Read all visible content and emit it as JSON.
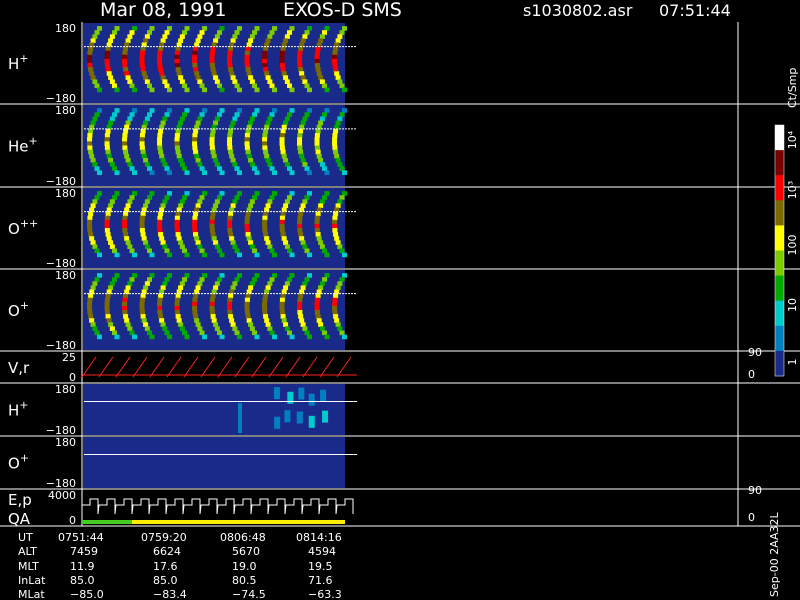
{
  "header": {
    "date": "Mar 08, 1991",
    "instrument": "EXOS-D SMS",
    "filename": "s1030802.asr",
    "time": "07:51:44"
  },
  "colorbar": {
    "unit_label": "Ct/Smp",
    "tick_labels": [
      "10⁴",
      "10³",
      "100",
      "10",
      "1"
    ],
    "tick_values": [
      10000,
      1000,
      100,
      10,
      1
    ],
    "colors": [
      "#ffffff",
      "#7a0000",
      "#ff0000",
      "#7a6a00",
      "#ffff00",
      "#7dcc00",
      "#00aa00",
      "#00cccc",
      "#0080c0",
      "#1a2a8a"
    ]
  },
  "side_annotation": "Sep-00  2AA32L",
  "chart_data": {
    "type": "heatmap",
    "x_axis": "UT",
    "panels": [
      {
        "label": "H",
        "superscript": "+",
        "y_top": "180",
        "y_bottom": "−180",
        "kind": "pitch-angle spectrogram"
      },
      {
        "label": "He",
        "superscript": "+",
        "y_top": "180",
        "y_bottom": "−180",
        "kind": "pitch-angle spectrogram"
      },
      {
        "label": "O",
        "superscript": "++",
        "y_top": "180",
        "y_bottom": "−180",
        "kind": "pitch-angle spectrogram"
      },
      {
        "label": "O",
        "superscript": "+",
        "y_top": "180",
        "y_bottom": "−180",
        "kind": "pitch-angle spectrogram"
      },
      {
        "label": "V,r",
        "superscript": "",
        "y_top": "25",
        "y_bottom": "0",
        "right_top": "90",
        "right_bottom": "0",
        "kind": "line"
      },
      {
        "label": "H",
        "superscript": "+",
        "y_top": "180",
        "y_bottom": "−180",
        "kind": "spectrogram"
      },
      {
        "label": "O",
        "superscript": "+",
        "y_top": "180",
        "y_bottom": "−180",
        "kind": "spectrogram"
      },
      {
        "label": "E,p",
        "label2": "QA",
        "superscript": "",
        "y_top": "4000",
        "y_bottom": "0",
        "right_top": "90",
        "right_bottom": "0",
        "kind": "line"
      }
    ],
    "time_ticks": [
      "0751:44",
      "0759:20",
      "0806:48",
      "0814:16"
    ],
    "ephemeris": [
      {
        "name": "UT",
        "values": [
          "0751:44",
          "0759:20",
          "0806:48",
          "0814:16"
        ]
      },
      {
        "name": "ALT",
        "values": [
          "7459",
          "6624",
          "5670",
          "4594"
        ]
      },
      {
        "name": "MLT",
        "values": [
          "11.9",
          "17.6",
          "19.0",
          "19.5"
        ]
      },
      {
        "name": "InLat",
        "values": [
          "85.0",
          "85.0",
          "80.5",
          "71.6"
        ]
      },
      {
        "name": "MLat",
        "values": [
          "−85.0",
          "−83.4",
          "−74.5",
          "−63.3"
        ]
      }
    ]
  }
}
